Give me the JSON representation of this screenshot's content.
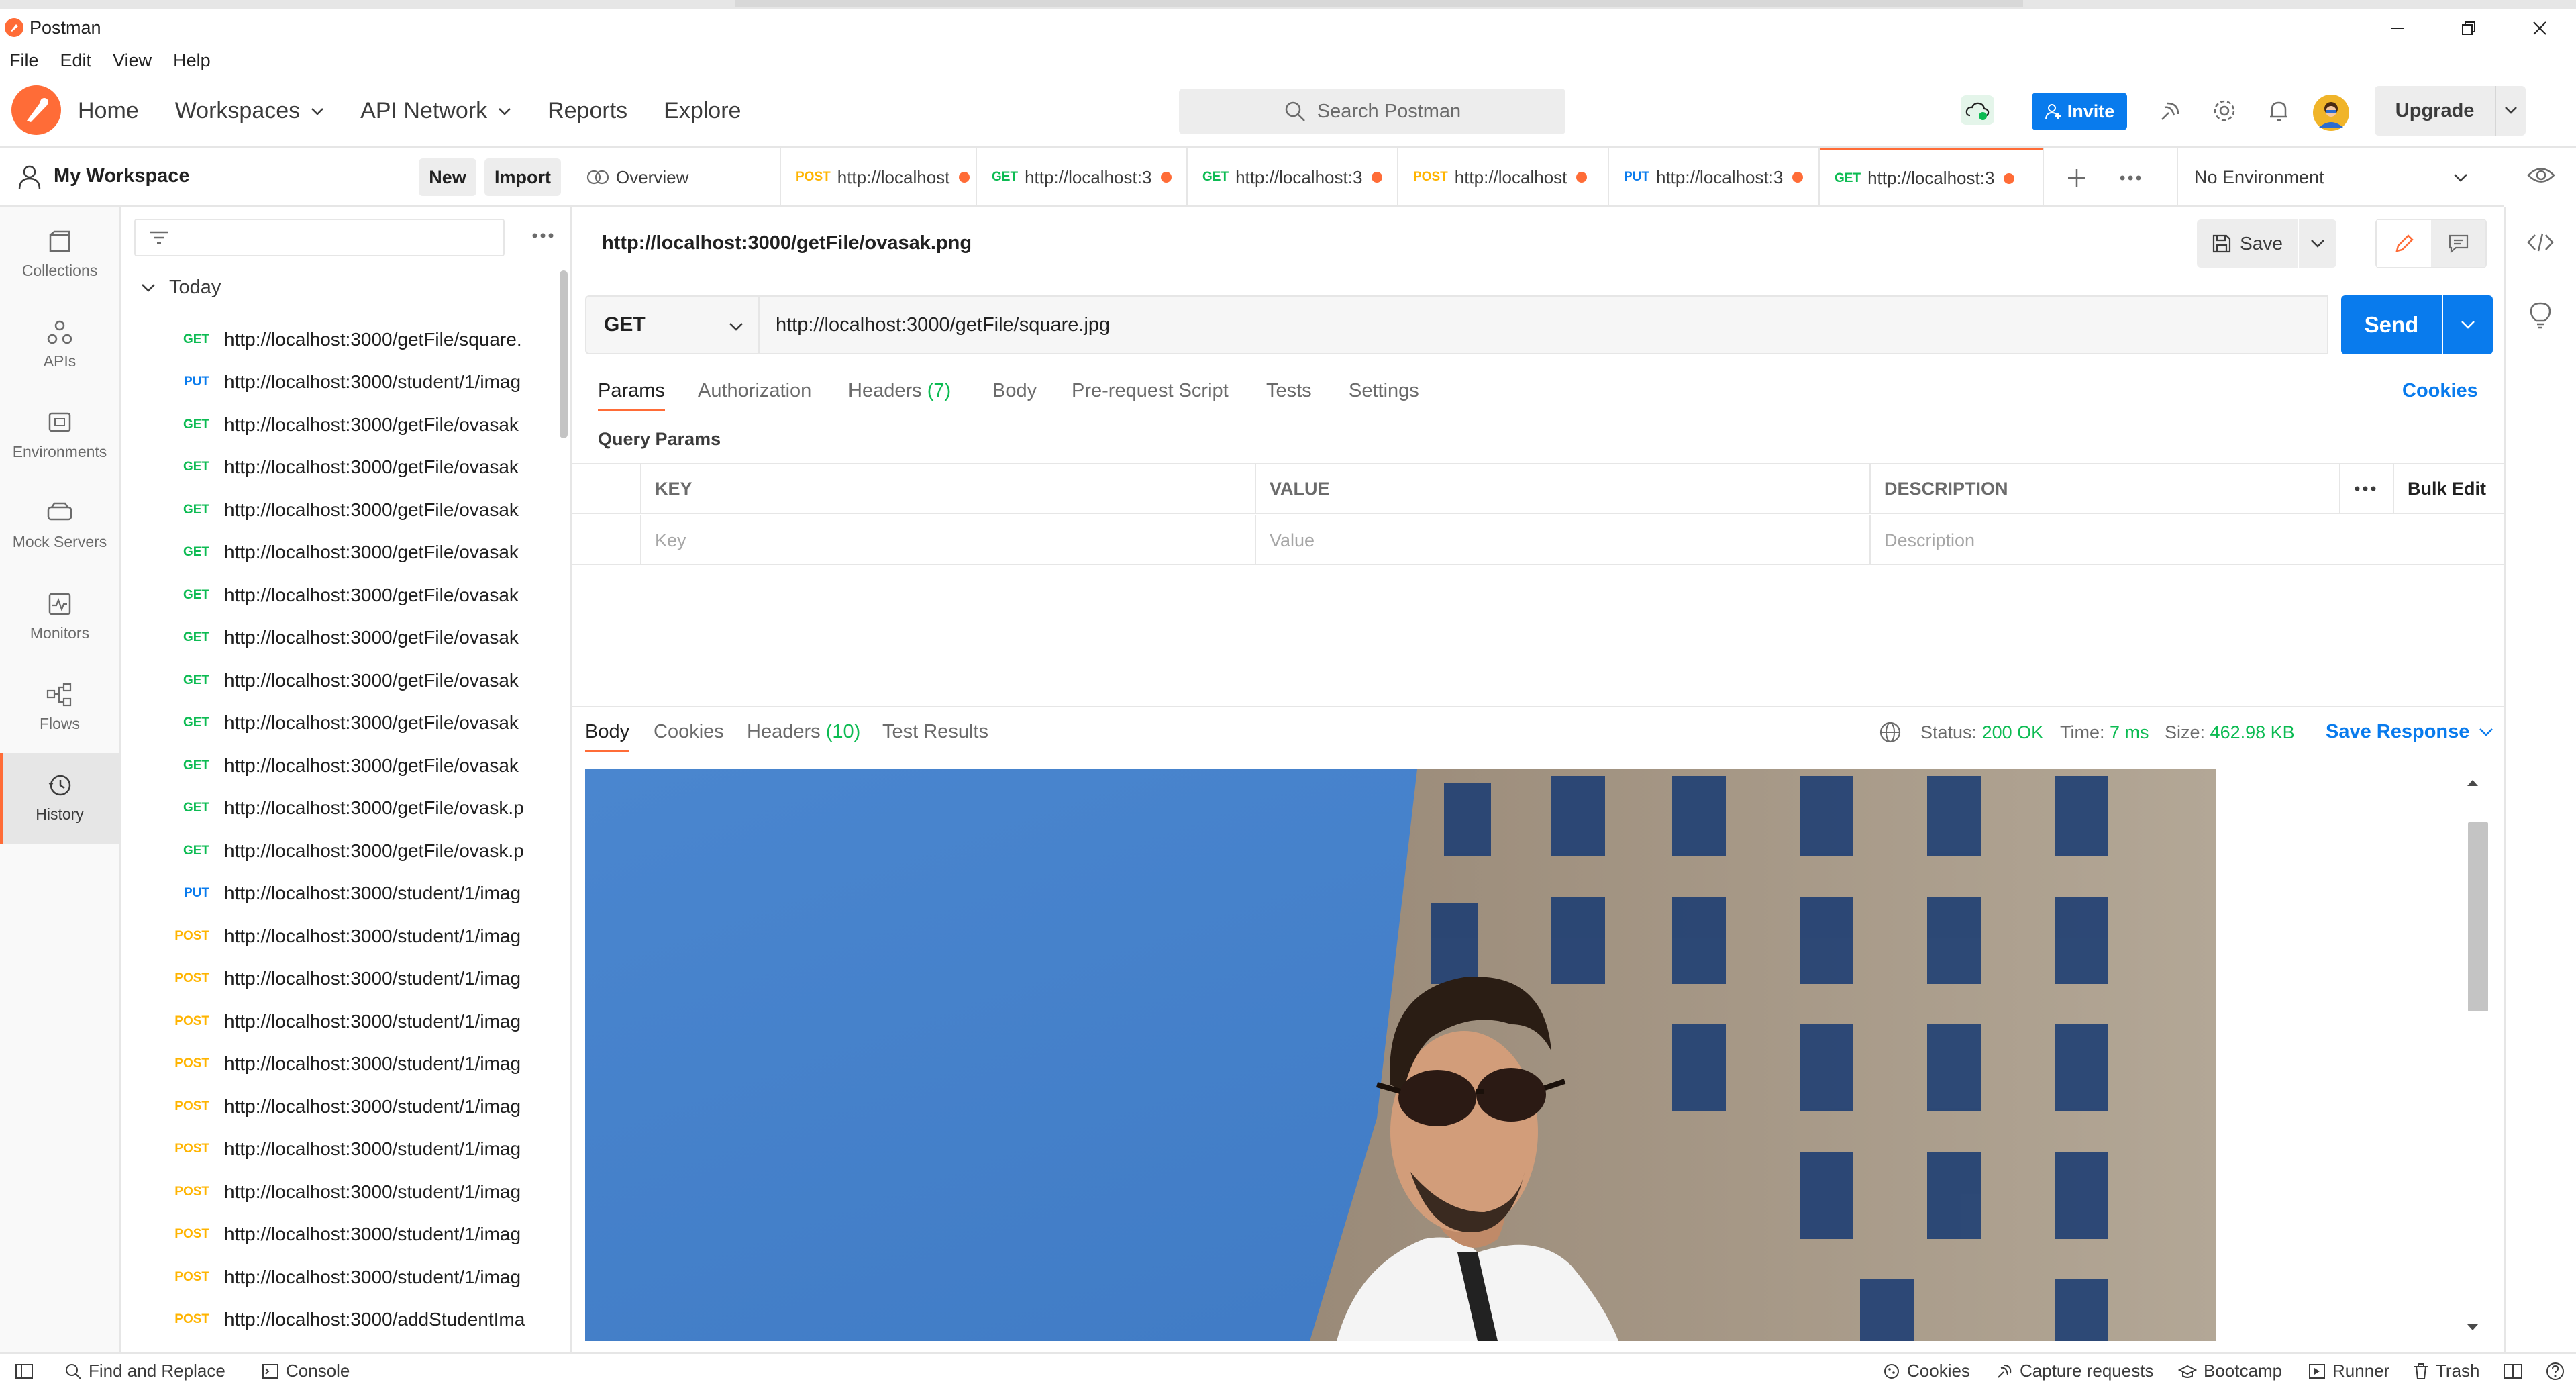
{
  "window": {
    "title": "Postman"
  },
  "menu": [
    "File",
    "Edit",
    "View",
    "Help"
  ],
  "header": {
    "nav": [
      {
        "label": "Home",
        "dropdown": false
      },
      {
        "label": "Workspaces",
        "dropdown": true
      },
      {
        "label": "API Network",
        "dropdown": true
      },
      {
        "label": "Reports",
        "dropdown": false
      },
      {
        "label": "Explore",
        "dropdown": false
      }
    ],
    "search_placeholder": "Search Postman",
    "invite_label": "Invite",
    "upgrade_label": "Upgrade",
    "brand_color": "#ff6c37",
    "accent_color": "#097bed"
  },
  "rail": {
    "items": [
      {
        "label": "Collections",
        "icon": "collections-icon",
        "active": false
      },
      {
        "label": "APIs",
        "icon": "apis-icon",
        "active": false
      },
      {
        "label": "Environments",
        "icon": "environments-icon",
        "active": false
      },
      {
        "label": "Mock Servers",
        "icon": "mock-servers-icon",
        "active": false
      },
      {
        "label": "Monitors",
        "icon": "monitors-icon",
        "active": false
      },
      {
        "label": "Flows",
        "icon": "flows-icon",
        "active": false
      },
      {
        "label": "History",
        "icon": "history-icon",
        "active": true
      }
    ]
  },
  "workspace": {
    "title": "My Workspace",
    "new_label": "New",
    "import_label": "Import"
  },
  "history": {
    "group_label": "Today",
    "items": [
      {
        "method": "GET",
        "url": "http://localhost:3000/getFile/square."
      },
      {
        "method": "PUT",
        "url": "http://localhost:3000/student/1/imag"
      },
      {
        "method": "GET",
        "url": "http://localhost:3000/getFile/ovasak"
      },
      {
        "method": "GET",
        "url": "http://localhost:3000/getFile/ovasak"
      },
      {
        "method": "GET",
        "url": "http://localhost:3000/getFile/ovasak"
      },
      {
        "method": "GET",
        "url": "http://localhost:3000/getFile/ovasak"
      },
      {
        "method": "GET",
        "url": "http://localhost:3000/getFile/ovasak"
      },
      {
        "method": "GET",
        "url": "http://localhost:3000/getFile/ovasak"
      },
      {
        "method": "GET",
        "url": "http://localhost:3000/getFile/ovasak"
      },
      {
        "method": "GET",
        "url": "http://localhost:3000/getFile/ovasak"
      },
      {
        "method": "GET",
        "url": "http://localhost:3000/getFile/ovasak"
      },
      {
        "method": "GET",
        "url": "http://localhost:3000/getFile/ovask.p"
      },
      {
        "method": "GET",
        "url": "http://localhost:3000/getFile/ovask.p"
      },
      {
        "method": "PUT",
        "url": "http://localhost:3000/student/1/imag"
      },
      {
        "method": "POST",
        "url": "http://localhost:3000/student/1/imag"
      },
      {
        "method": "POST",
        "url": "http://localhost:3000/student/1/imag"
      },
      {
        "method": "POST",
        "url": "http://localhost:3000/student/1/imag"
      },
      {
        "method": "POST",
        "url": "http://localhost:3000/student/1/imag"
      },
      {
        "method": "POST",
        "url": "http://localhost:3000/student/1/imag"
      },
      {
        "method": "POST",
        "url": "http://localhost:3000/student/1/imag"
      },
      {
        "method": "POST",
        "url": "http://localhost:3000/student/1/imag"
      },
      {
        "method": "POST",
        "url": "http://localhost:3000/student/1/imag"
      },
      {
        "method": "POST",
        "url": "http://localhost:3000/student/1/imag"
      },
      {
        "method": "POST",
        "url": "http://localhost:3000/addStudentIma"
      },
      {
        "method": "POST",
        "url": "http://localhost:3000/addStudentIma"
      }
    ]
  },
  "tabs": {
    "overview_label": "Overview",
    "items": [
      {
        "method": "POST",
        "label": "http://localhost",
        "active": false
      },
      {
        "method": "GET",
        "label": "http://localhost:3",
        "active": false
      },
      {
        "method": "GET",
        "label": "http://localhost:3",
        "active": false
      },
      {
        "method": "POST",
        "label": "http://localhost",
        "active": false
      },
      {
        "method": "PUT",
        "label": "http://localhost:3",
        "active": false
      },
      {
        "method": "GET",
        "label": "http://localhost:3",
        "active": true
      }
    ],
    "environment": "No Environment"
  },
  "request": {
    "title": "http://localhost:3000/getFile/ovasak.png",
    "save_label": "Save",
    "method": "GET",
    "url": "http://localhost:3000/getFile/square.jpg",
    "send_label": "Send",
    "tabs": [
      {
        "label": "Params",
        "count": ""
      },
      {
        "label": "Authorization",
        "count": ""
      },
      {
        "label": "Headers",
        "count": "(7)"
      },
      {
        "label": "Body",
        "count": ""
      },
      {
        "label": "Pre-request Script",
        "count": ""
      },
      {
        "label": "Tests",
        "count": ""
      },
      {
        "label": "Settings",
        "count": ""
      }
    ],
    "cookies_label": "Cookies",
    "query_params_label": "Query Params",
    "params_table": {
      "headers": [
        "KEY",
        "VALUE",
        "DESCRIPTION"
      ],
      "bulk_edit_label": "Bulk Edit",
      "placeholders": [
        "Key",
        "Value",
        "Description"
      ]
    }
  },
  "response": {
    "tabs": [
      {
        "label": "Body",
        "count": ""
      },
      {
        "label": "Cookies",
        "count": ""
      },
      {
        "label": "Headers",
        "count": "(10)"
      },
      {
        "label": "Test Results",
        "count": ""
      }
    ],
    "status_label": "Status:",
    "status_value": "200 OK",
    "time_label": "Time:",
    "time_value": "7 ms",
    "size_label": "Size:",
    "size_value": "462.98 KB",
    "save_response_label": "Save Response"
  },
  "statusbar": {
    "find_replace": "Find and Replace",
    "console": "Console",
    "cookies": "Cookies",
    "capture": "Capture requests",
    "bootcamp": "Bootcamp",
    "runner": "Runner",
    "trash": "Trash"
  }
}
